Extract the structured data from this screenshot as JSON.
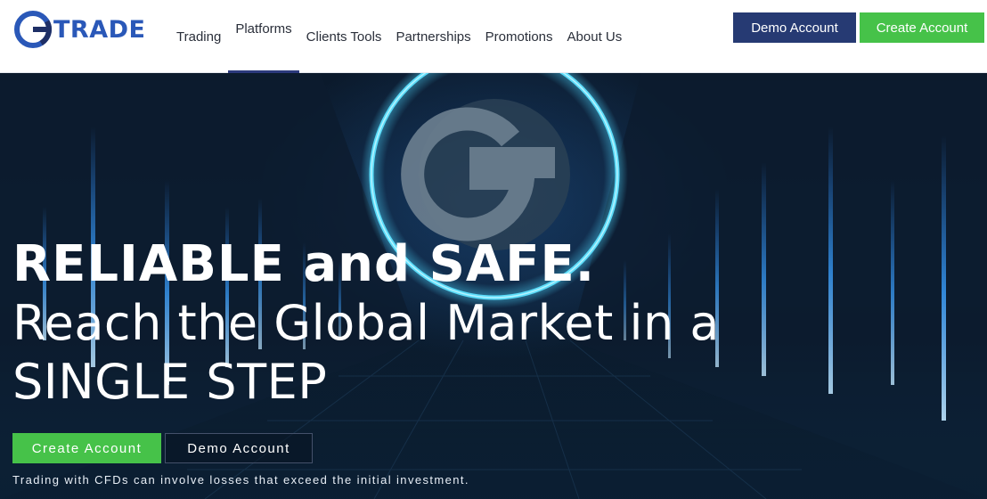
{
  "brand": {
    "logo_text": "TRADE",
    "colors": {
      "primary": "#263a73",
      "accent": "#46c249",
      "logo_blue": "#2a58b8"
    }
  },
  "nav": {
    "items": [
      {
        "label": "Trading"
      },
      {
        "label": "Platforms",
        "active": true
      },
      {
        "label": "Clients Tools"
      },
      {
        "label": "Partnerships"
      },
      {
        "label": "Promotions"
      },
      {
        "label": "About Us"
      }
    ]
  },
  "header_actions": {
    "demo_label": "Demo Account",
    "create_label": "Create Account"
  },
  "hero": {
    "headline": "RELIABLE and SAFE.",
    "subline": "Reach the Global Market in a SINGLE STEP",
    "create_label": "Create Account",
    "demo_label": "Demo Account",
    "disclaimer": "Trading with CFDs can involve losses that exceed the initial investment."
  }
}
